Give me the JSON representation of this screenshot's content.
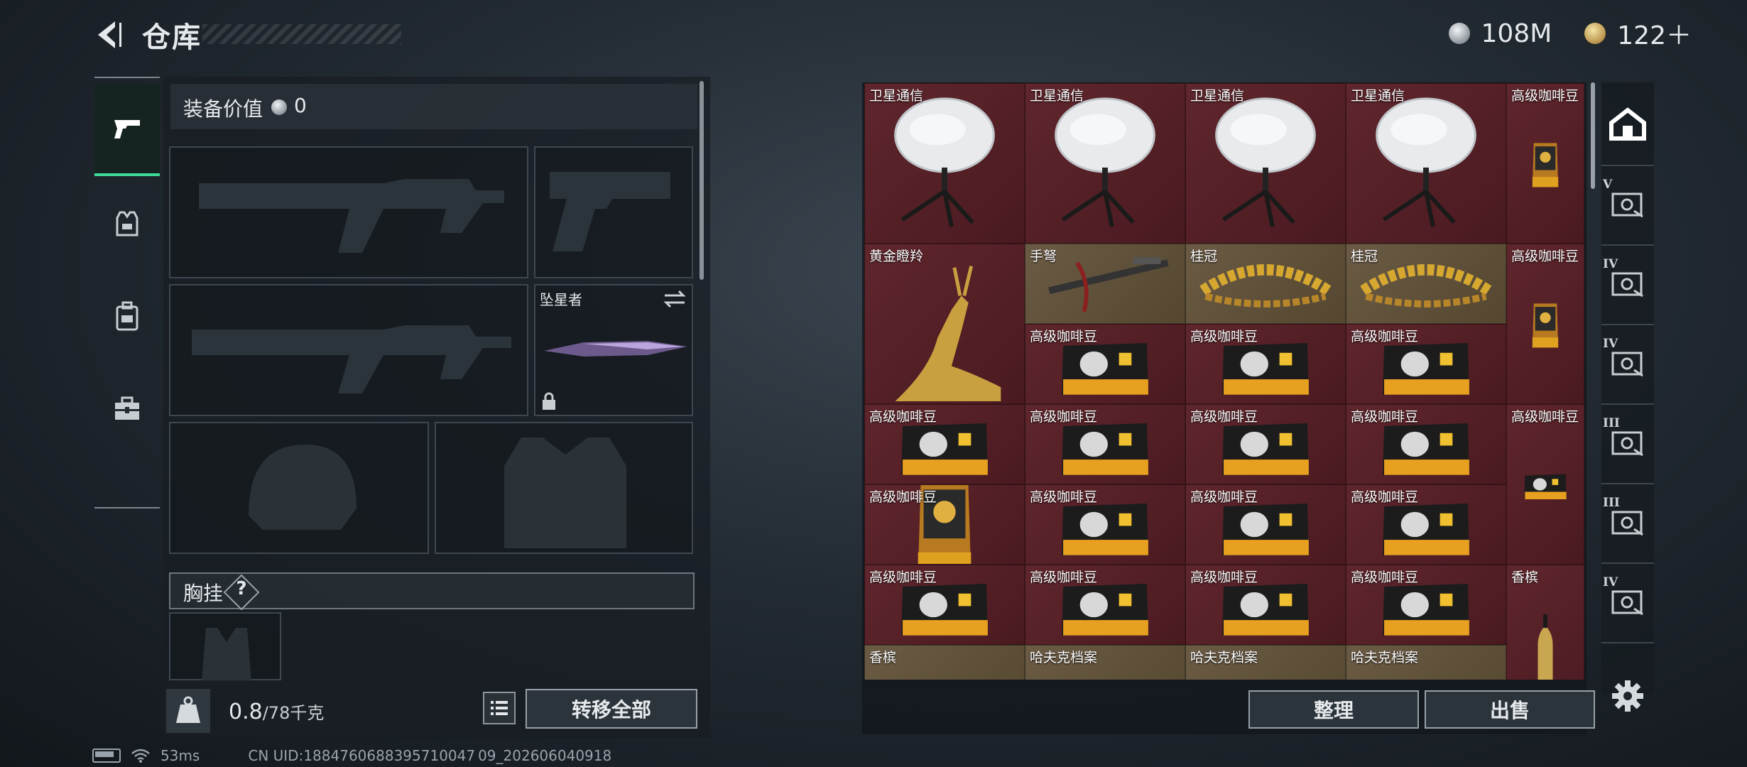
{
  "header": {
    "title": "仓库",
    "back_icon": "back-arrow-icon"
  },
  "currency": {
    "silver_amount": "108M",
    "gold_amount": "122＋",
    "silver_icon": "silver-coin-icon",
    "gold_icon": "gold-coin-icon"
  },
  "left_nav": {
    "items": [
      {
        "icon": "pistol-icon",
        "active": true
      },
      {
        "icon": "vest-icon",
        "active": false
      },
      {
        "icon": "backpack-icon",
        "active": false
      },
      {
        "icon": "toolbox-icon",
        "active": false
      }
    ]
  },
  "loadout": {
    "equipment_value_label": "装备价值",
    "equipment_value": "0",
    "melee_name": "坠星者",
    "chest_rig_label": "胸挂",
    "chest_help": "?",
    "weight_current": "0.8",
    "weight_max": "/78千克",
    "transfer_all_label": "转移全部"
  },
  "storage": {
    "items": [
      {
        "label": "卫星通信",
        "art": "dish"
      },
      {
        "label": "卫星通信",
        "art": "dish"
      },
      {
        "label": "卫星通信",
        "art": "dish"
      },
      {
        "label": "卫星通信",
        "art": "dish"
      },
      {
        "label": "高级咖啡豆",
        "art": "bag"
      },
      {
        "label": "黄金瞪羚",
        "art": "gazelle"
      },
      {
        "label": "手弩",
        "art": "crossbow"
      },
      {
        "label": "桂冠",
        "art": "laurel"
      },
      {
        "label": "桂冠",
        "art": "laurel"
      },
      {
        "label": "高级咖啡豆",
        "art": "bag"
      },
      {
        "label": "高级咖啡豆",
        "art": "pack"
      },
      {
        "label": "高级咖啡豆",
        "art": "pack"
      },
      {
        "label": "高级咖啡豆",
        "art": "pack"
      },
      {
        "label": "高级咖啡豆",
        "art": "pack"
      },
      {
        "label": "高级咖啡豆",
        "art": "pack"
      },
      {
        "label": "高级咖啡豆",
        "art": "pack"
      },
      {
        "label": "高级咖啡豆",
        "art": "pack"
      },
      {
        "label": "高级咖啡豆",
        "art": "bag"
      },
      {
        "label": "高级咖啡豆",
        "art": "pack"
      },
      {
        "label": "高级咖啡豆",
        "art": "pack"
      },
      {
        "label": "高级咖啡豆",
        "art": "pack"
      },
      {
        "label": "高级咖啡豆",
        "art": "pack"
      },
      {
        "label": "高级咖啡豆",
        "art": "pack"
      },
      {
        "label": "高级咖啡豆",
        "art": "pack"
      },
      {
        "label": "高级咖啡豆",
        "art": "pack"
      },
      {
        "label": "高级咖啡豆",
        "art": "pack"
      },
      {
        "label": "香槟",
        "art": "bottle"
      },
      {
        "label": "香槟",
        "art": "bottle-lying"
      },
      {
        "label": "哈夫克档案",
        "art": "file"
      },
      {
        "label": "哈夫克档案",
        "art": "file"
      },
      {
        "label": "哈夫克档案",
        "art": "file"
      }
    ],
    "sort_label": "整理",
    "sell_label": "出售"
  },
  "right_tabs": [
    {
      "icon": "warehouse-icon",
      "tier": ""
    },
    {
      "icon": "case-v-icon",
      "tier": "V"
    },
    {
      "icon": "case-iv-icon",
      "tier": "IV"
    },
    {
      "icon": "case-iv-icon",
      "tier": "IV"
    },
    {
      "icon": "case-iii-icon",
      "tier": "III"
    },
    {
      "icon": "case-iii-icon",
      "tier": "III"
    },
    {
      "icon": "case-iv-icon",
      "tier": "IV"
    }
  ],
  "status_bar": {
    "ping": "53ms",
    "uid": "CN UID:1884760688395710047 09_202606040918"
  }
}
